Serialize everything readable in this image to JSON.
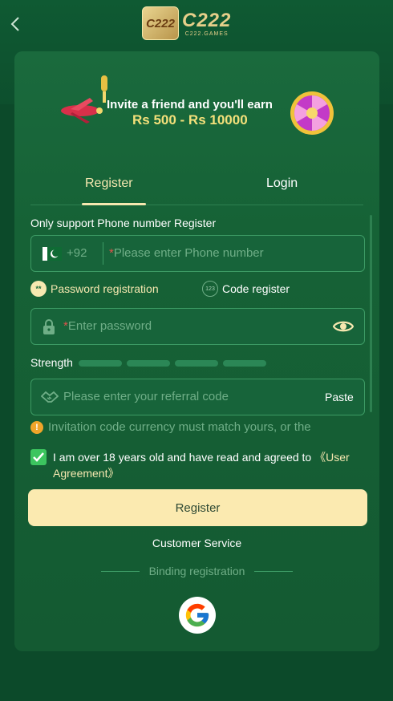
{
  "header": {
    "logo_badge": "C222",
    "logo_text": "C222",
    "logo_subtext": "C222.GAMES"
  },
  "banner": {
    "line1": "Invite a friend and you'll earn",
    "line2": "Rs 500 - Rs 10000"
  },
  "tabs": [
    {
      "label": "Register",
      "active": true
    },
    {
      "label": "Login",
      "active": false
    }
  ],
  "form": {
    "support_label": "Only support Phone number Register",
    "country_code": "+92",
    "phone_placeholder": "Please enter Phone number",
    "required_mark": "*",
    "options": {
      "password": "Password registration",
      "code": "Code register",
      "code_icon": "123",
      "password_icon": "**"
    },
    "password_placeholder": "Enter password",
    "strength_label": "Strength",
    "strength_level": 0,
    "referral_placeholder": "Please enter your referral code",
    "paste_label": "Paste",
    "warning": "Invitation code currency must match yours, or the",
    "agree_text": "I am over 18 years old and have read and agreed to ",
    "agree_link": "《User Agreement》",
    "agree_checked": true,
    "register_button": "Register",
    "customer_service": "Customer Service",
    "binding_label": "Binding registration"
  },
  "colors": {
    "accent": "#f6e8b0",
    "background": "#0c4a2a",
    "card": "#166236",
    "check": "#3cc55f"
  },
  "icons": [
    "back-arrow-icon",
    "pakistan-flag-icon",
    "lock-icon",
    "eye-icon",
    "handshake-icon",
    "warning-icon",
    "checkmark-icon",
    "google-icon"
  ]
}
